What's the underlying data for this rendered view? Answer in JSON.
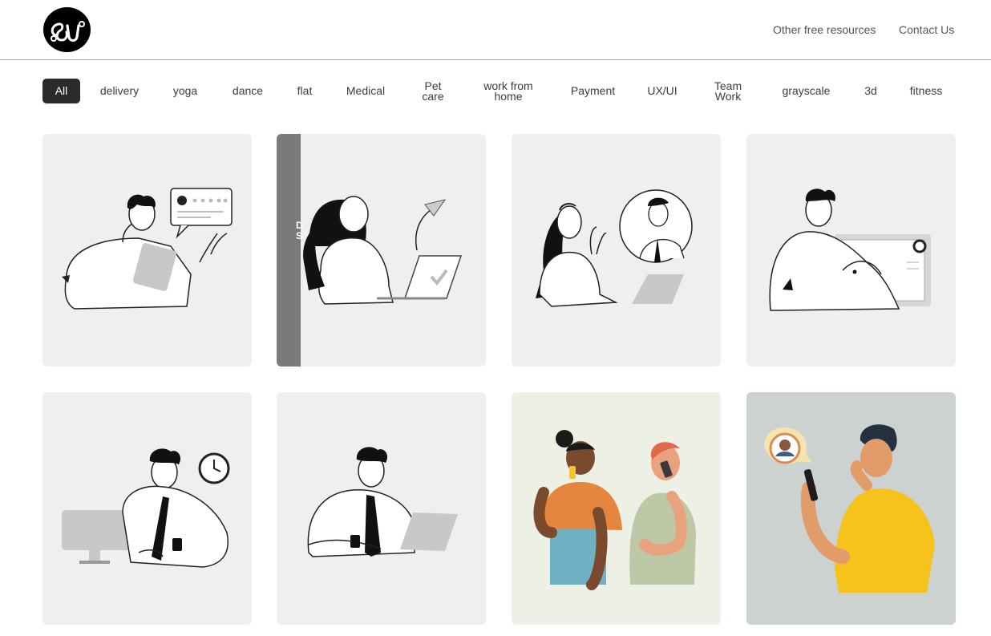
{
  "header": {
    "logo_alt": "SU",
    "nav": [
      {
        "label": "Other free resources"
      },
      {
        "label": "Contact Us"
      }
    ]
  },
  "filters": [
    {
      "label": "All",
      "active": true
    },
    {
      "label": "delivery"
    },
    {
      "label": "yoga"
    },
    {
      "label": "dance"
    },
    {
      "label": "flat"
    },
    {
      "label": "Medical"
    },
    {
      "label": "Pet\ncare"
    },
    {
      "label": "work from\nhome"
    },
    {
      "label": "Payment"
    },
    {
      "label": "UX/UI"
    },
    {
      "label": "Team\nWork"
    },
    {
      "label": "grayscale"
    },
    {
      "label": "3d"
    },
    {
      "label": "fitness"
    }
  ],
  "cards": [
    {
      "name": "man-tablet-review",
      "overlay": ""
    },
    {
      "name": "woman-laptop-send",
      "overlay": "D\nS"
    },
    {
      "name": "woman-video-call",
      "overlay": ""
    },
    {
      "name": "man-drawing-tablet",
      "overlay": ""
    },
    {
      "name": "man-computer-clock",
      "overlay": ""
    },
    {
      "name": "man-tablet-office",
      "overlay": ""
    },
    {
      "name": "people-phone-call",
      "overlay": ""
    },
    {
      "name": "man-phone-message",
      "overlay": ""
    }
  ],
  "colors": {
    "active_chip": "#2b2b2b",
    "card_bg": "#efefef",
    "card_bg_cream": "#edf0e4",
    "card_bg_sage": "#ccd2cf"
  }
}
